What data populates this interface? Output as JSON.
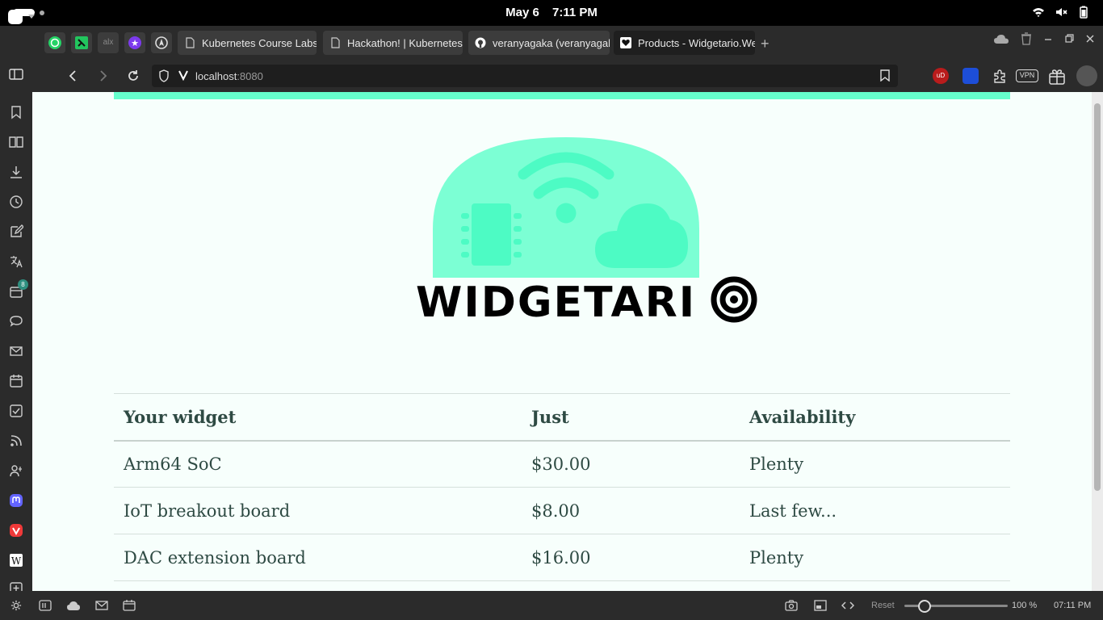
{
  "os_bar": {
    "date": "May 6",
    "time": "7:11 PM"
  },
  "tabs": [
    {
      "label": "Kubernetes Course Labs ...",
      "favicon": "document-icon"
    },
    {
      "label": "Hackathon! | Kubernetes ...",
      "favicon": "document-icon"
    },
    {
      "label": "veranyagaka (veranyagaka)",
      "favicon": "github-icon"
    },
    {
      "label": "Products - Widgetario.Web",
      "favicon": "heart-icon",
      "active": true
    }
  ],
  "pinned_tabs": [
    "whatsapp-icon",
    "green-app-icon",
    "alx-icon",
    "purple-star-icon",
    "nav-app-icon"
  ],
  "pinned_alx_label": "alx",
  "address": {
    "host": "localhost",
    "port": ":8080"
  },
  "extensions": {
    "vpn_label": "VPN",
    "ublock_label": "uD"
  },
  "sidebar_badge": "8",
  "page": {
    "brand": "WIDGETARI",
    "table": {
      "headers": [
        "Your widget",
        "Just",
        "Availability"
      ],
      "rows": [
        [
          "Arm64 SoC",
          "$30.00",
          "Plenty"
        ],
        [
          "IoT breakout board",
          "$8.00",
          "Last few..."
        ],
        [
          "DAC extension board",
          "$16.00",
          "Plenty"
        ]
      ]
    },
    "colors": {
      "accent": "#66ffcc",
      "dome": "#5dfdc8",
      "text": "#2e4a43",
      "background": "#f7fffc"
    }
  },
  "status": {
    "reset_label": "Reset",
    "zoom": "100 %",
    "time": "07:11 PM"
  }
}
